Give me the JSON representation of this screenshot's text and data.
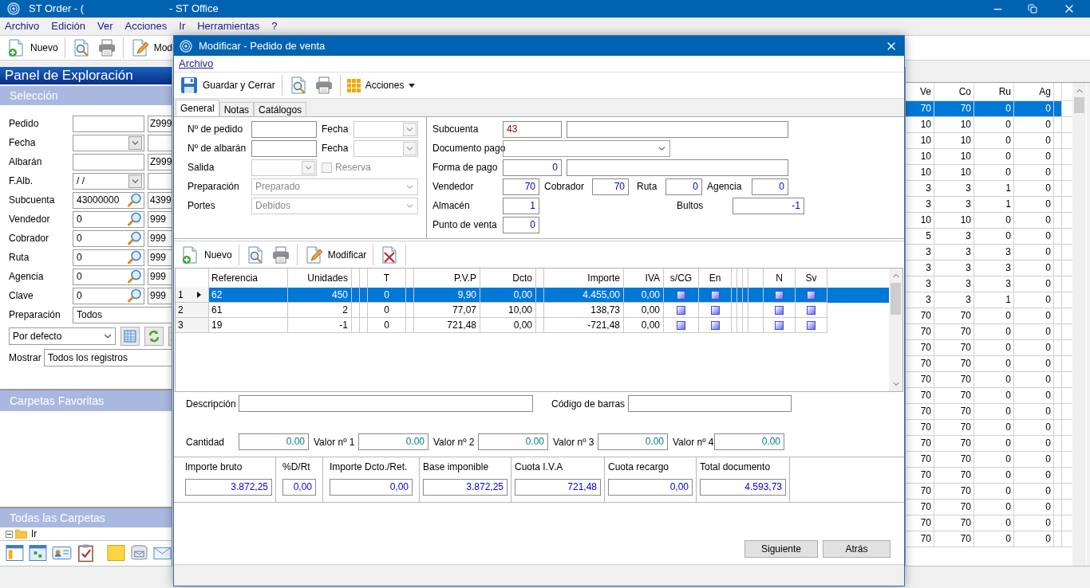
{
  "window": {
    "title_parts": [
      "ST Order - (",
      "- ST Office"
    ]
  },
  "menu": [
    {
      "label": "Archivo"
    },
    {
      "label": "Edición"
    },
    {
      "label": "Ver"
    },
    {
      "label": "Acciones"
    },
    {
      "label": "Ir"
    },
    {
      "label": "Herramientas"
    },
    {
      "label": "?"
    }
  ],
  "toolbar": [
    {
      "kind": "new",
      "label": "Nuevo"
    },
    {
      "kind": "separator"
    },
    {
      "kind": "preview"
    },
    {
      "kind": "print"
    },
    {
      "kind": "separator"
    },
    {
      "kind": "edit",
      "label": "Modi"
    }
  ],
  "explorer": {
    "title": "Panel de Exploración",
    "selection_title": "Selección",
    "filters": [
      {
        "label": "Pedido",
        "kind": "text",
        "to": "Z999"
      },
      {
        "label": "Fecha",
        "kind": "date"
      },
      {
        "label": "Albarán",
        "kind": "text",
        "to": "Z999"
      },
      {
        "label": "F.Alb.",
        "kind": "date",
        "value": "/ /"
      },
      {
        "label": "Subcuenta",
        "kind": "lookup",
        "value": "43000000",
        "to": "4399"
      },
      {
        "label": "Vendedor",
        "kind": "lookup",
        "value": "0",
        "to": "999"
      },
      {
        "label": "Cobrador",
        "kind": "lookup",
        "value": "0",
        "to": "999"
      },
      {
        "label": "Ruta",
        "kind": "lookup",
        "value": "0",
        "to": "999"
      },
      {
        "label": "Agencia",
        "kind": "lookup",
        "value": "0",
        "to": "999"
      },
      {
        "label": "Clave",
        "kind": "lookup",
        "value": "0",
        "to": "999"
      },
      {
        "label": "Preparación",
        "kind": "wide",
        "value": "Todos"
      }
    ],
    "view": {
      "value": "Por defecto"
    },
    "show": {
      "label": "Mostrar",
      "value": "Todos los registros"
    },
    "favorites_title": "Carpetas Favoritas",
    "folders_title": "Todas las Carpetas",
    "tree": [
      {
        "label": "Ir",
        "expanded": true
      }
    ]
  },
  "list": {
    "columns": [
      "Ve",
      "Co",
      "Ru",
      "Ag"
    ],
    "rows": [
      {
        "cells": [
          "70",
          "70",
          "0",
          "0"
        ],
        "selected": true
      },
      {
        "cells": [
          "10",
          "10",
          "0",
          "0"
        ],
        "selected": false
      },
      {
        "cells": [
          "10",
          "10",
          "0",
          "0"
        ],
        "selected": false
      },
      {
        "cells": [
          "10",
          "10",
          "0",
          "0"
        ],
        "selected": false
      },
      {
        "cells": [
          "10",
          "10",
          "0",
          "0"
        ],
        "selected": false
      },
      {
        "cells": [
          "3",
          "3",
          "1",
          "0"
        ],
        "selected": false
      },
      {
        "cells": [
          "3",
          "3",
          "1",
          "0"
        ],
        "selected": false
      },
      {
        "cells": [
          "10",
          "10",
          "0",
          "0"
        ],
        "selected": false
      },
      {
        "cells": [
          "5",
          "3",
          "0",
          "0"
        ],
        "selected": false
      },
      {
        "cells": [
          "3",
          "3",
          "3",
          "0"
        ],
        "selected": false
      },
      {
        "cells": [
          "3",
          "3",
          "3",
          "0"
        ],
        "selected": false
      },
      {
        "cells": [
          "3",
          "3",
          "3",
          "0"
        ],
        "selected": false
      },
      {
        "cells": [
          "3",
          "3",
          "1",
          "0"
        ],
        "selected": false
      },
      {
        "cells": [
          "70",
          "70",
          "0",
          "0"
        ],
        "selected": false
      },
      {
        "cells": [
          "70",
          "70",
          "0",
          "0"
        ],
        "selected": false
      },
      {
        "cells": [
          "70",
          "70",
          "0",
          "0"
        ],
        "selected": false
      },
      {
        "cells": [
          "70",
          "70",
          "0",
          "0"
        ],
        "selected": false
      },
      {
        "cells": [
          "70",
          "70",
          "0",
          "0"
        ],
        "selected": false
      },
      {
        "cells": [
          "70",
          "70",
          "0",
          "0"
        ],
        "selected": false
      },
      {
        "cells": [
          "70",
          "70",
          "0",
          "0"
        ],
        "selected": false
      },
      {
        "cells": [
          "70",
          "70",
          "0",
          "0"
        ],
        "selected": false
      },
      {
        "cells": [
          "70",
          "70",
          "0",
          "0"
        ],
        "selected": false
      },
      {
        "cells": [
          "70",
          "70",
          "0",
          "0"
        ],
        "selected": false
      },
      {
        "cells": [
          "70",
          "70",
          "0",
          "0"
        ],
        "selected": false
      },
      {
        "cells": [
          "70",
          "70",
          "0",
          "0"
        ],
        "selected": false
      },
      {
        "cells": [
          "70",
          "70",
          "0",
          "0"
        ],
        "selected": false
      },
      {
        "cells": [
          "70",
          "70",
          "0",
          "0"
        ],
        "selected": false
      },
      {
        "cells": [
          "70",
          "70",
          "0",
          "0"
        ],
        "selected": false
      }
    ]
  },
  "dialog": {
    "title": "Modificar - Pedido de venta",
    "menu": [
      "Archivo"
    ],
    "toolbar": [
      {
        "kind": "save",
        "label": "Guardar y Cerrar"
      },
      {
        "kind": "separator"
      },
      {
        "kind": "preview"
      },
      {
        "kind": "print"
      },
      {
        "kind": "separator"
      },
      {
        "kind": "actions",
        "label": "Acciones"
      }
    ],
    "tabs": [
      {
        "label": "General",
        "selected": true
      },
      {
        "label": "Notas",
        "selected": false
      },
      {
        "label": "Catálogos",
        "selected": false
      }
    ],
    "order_number": {
      "label": "Nº de pedido"
    },
    "order_date": {
      "label": "Fecha"
    },
    "delivery_number": {
      "label": "Nº de albarán"
    },
    "delivery_date": {
      "label": "Fecha"
    },
    "exit": {
      "label": "Salida"
    },
    "reserve": {
      "label": "Reserva",
      "checked": false,
      "disabled": true
    },
    "preparation": {
      "label": "Preparación",
      "value": "Preparado",
      "disabled": true
    },
    "shipping": {
      "label": "Portes",
      "value": "Debidos",
      "disabled": true
    },
    "account": {
      "label": "Subcuenta",
      "value": "43"
    },
    "payment_document": {
      "label": "Documento pago"
    },
    "payment_method": {
      "label": "Forma de pago",
      "value": "0"
    },
    "seller": {
      "label": "Vendedor",
      "value": "70"
    },
    "collector": {
      "label": "Cobrador",
      "value": "70"
    },
    "route": {
      "label": "Ruta",
      "value": "0"
    },
    "agency": {
      "label": "Agencia",
      "value": "0"
    },
    "warehouse": {
      "label": "Almacén",
      "value": "1"
    },
    "packages": {
      "label": "Bultos",
      "value": "-1"
    },
    "point_of_sale": {
      "label": "Punto de venta",
      "value": "0"
    },
    "lines_toolbar": [
      {
        "kind": "new",
        "label": "Nuevo"
      },
      {
        "kind": "separator"
      },
      {
        "kind": "preview"
      },
      {
        "kind": "print"
      },
      {
        "kind": "separator"
      },
      {
        "kind": "edit",
        "label": "Modificar"
      },
      {
        "kind": "separator"
      },
      {
        "kind": "delete"
      },
      {
        "kind": "separator"
      }
    ],
    "lines": {
      "columns": [
        {
          "kind": "text",
          "label": "Referencia"
        },
        {
          "kind": "number",
          "label": "Unidades"
        },
        {
          "kind": "blank"
        },
        {
          "kind": "blank"
        },
        {
          "kind": "center",
          "label": "T"
        },
        {
          "kind": "blank"
        },
        {
          "kind": "number",
          "label": "P.V.P"
        },
        {
          "kind": "number",
          "label": "Dcto"
        },
        {
          "kind": "blank"
        },
        {
          "kind": "number",
          "label": "Importe"
        },
        {
          "kind": "number",
          "label": "IVA"
        },
        {
          "kind": "check",
          "label": "s/CG"
        },
        {
          "kind": "check",
          "label": "En"
        },
        {
          "kind": "blank"
        },
        {
          "kind": "blank"
        },
        {
          "kind": "blank"
        },
        {
          "kind": "blank"
        },
        {
          "kind": "check",
          "label": "N"
        },
        {
          "kind": "check",
          "label": "Sv"
        }
      ],
      "rows": [
        {
          "number": "1",
          "selected": true,
          "cells": [
            "62",
            "450",
            "",
            "",
            "0",
            "",
            "9,90",
            "0,00",
            "",
            "4.455,00",
            "0,00",
            "",
            "",
            "",
            "",
            "",
            "",
            "",
            ""
          ]
        },
        {
          "number": "2",
          "selected": false,
          "cells": [
            "61",
            "2",
            "",
            "",
            "0",
            "",
            "77,07",
            "10,00",
            "",
            "138,73",
            "0,00",
            "",
            "",
            "",
            "",
            "",
            "",
            "",
            ""
          ]
        },
        {
          "number": "3",
          "selected": false,
          "cells": [
            "19",
            "-1",
            "",
            "",
            "0",
            "",
            "721,48",
            "0,00",
            "",
            "-721,48",
            "0,00",
            "",
            "",
            "",
            "",
            "",
            "",
            "",
            ""
          ]
        }
      ]
    },
    "description": {
      "label": "Descripción"
    },
    "barcode": {
      "label": "Código de barras"
    },
    "quantities": [
      {
        "label": "Cantidad",
        "value": "0.00"
      },
      {
        "label": "Valor nº 1",
        "value": "0.00"
      },
      {
        "label": "Valor nº 2",
        "value": "0.00"
      },
      {
        "label": "Valor nº 3",
        "value": "0.00"
      },
      {
        "label": "Valor nº 4",
        "value": "0.00"
      }
    ],
    "totals": [
      {
        "label": "Importe bruto",
        "value": "3.872,25"
      },
      {
        "label": "%D/Rt",
        "value": "0,00"
      },
      {
        "label": "Importe Dcto./Ret.",
        "value": "0,00"
      },
      {
        "label": "Base imponible",
        "value": "3.872,25"
      },
      {
        "label": "Cuota I.V.A",
        "value": "721,48"
      },
      {
        "label": "Cuota recargo",
        "value": "0,00"
      },
      {
        "label": "Total documento",
        "value": "4.593,73"
      }
    ],
    "buttons": [
      {
        "label": "Siguiente"
      },
      {
        "label": "Atrás"
      }
    ]
  }
}
